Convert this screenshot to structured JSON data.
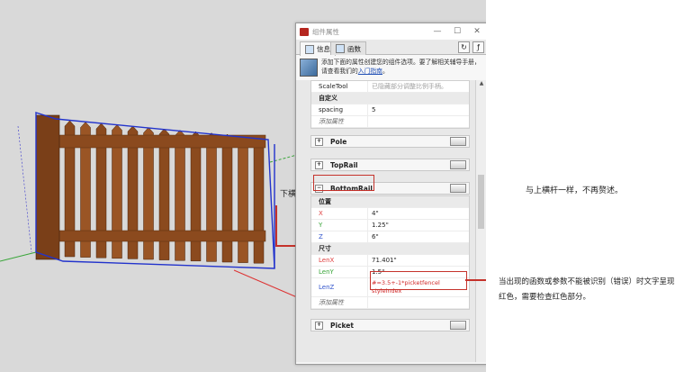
{
  "dialog": {
    "title": "组件属性",
    "window_buttons": [
      "—",
      "☐",
      "✕"
    ],
    "tabs": [
      {
        "label": "信息"
      },
      {
        "label": "函数"
      }
    ],
    "info_text": "添加下面的属性创建您的组件选项。要了解相关辅导手册，请查看我们的",
    "info_link": "入门指南",
    "info_end": "。",
    "top_table": [
      {
        "key": "ScaleTool",
        "value": "已隐藏部分调整比例手柄。",
        "style": "grey"
      },
      {
        "key": "自定义",
        "value": "",
        "style": "hdr"
      },
      {
        "key": "spacing",
        "value": "5",
        "style": "normal"
      },
      {
        "key": "添加属性",
        "value": "",
        "style": "italic"
      }
    ],
    "sections": {
      "pole": "Pole",
      "toprail": "TopRail",
      "bottomrail": "BottomRail",
      "picket": "Picket"
    },
    "bottomrail_rows": [
      {
        "key": "位置",
        "value": "",
        "style": "hdr"
      },
      {
        "key": "X",
        "value": "4\"",
        "style": "red"
      },
      {
        "key": "Y",
        "value": "1.25\"",
        "style": "green"
      },
      {
        "key": "Z",
        "value": "6\"",
        "style": "normal"
      },
      {
        "key": "尺寸",
        "value": "",
        "style": "hdr"
      },
      {
        "key": "LenX",
        "value": "71.401\"",
        "style": "red"
      },
      {
        "key": "LenY",
        "value": "1.5\"",
        "style": "green"
      },
      {
        "key": "LenZ",
        "value": "#=3.5+-1*picketfencel styleindex",
        "style": "error"
      },
      {
        "key": "添加属性",
        "value": "",
        "style": "italic"
      }
    ]
  },
  "annotations": {
    "bottom_rail_label": "下横杆",
    "same_as_top": "与上横杆一样，不再赘述。",
    "error_note": "当出现的函数或参数不能被识别（错误）时文字呈现红色，需要检查红色部分。"
  },
  "colors": {
    "highlight": "#c5322b",
    "selection": "#2233cc",
    "wood": "#8b4a1e"
  }
}
